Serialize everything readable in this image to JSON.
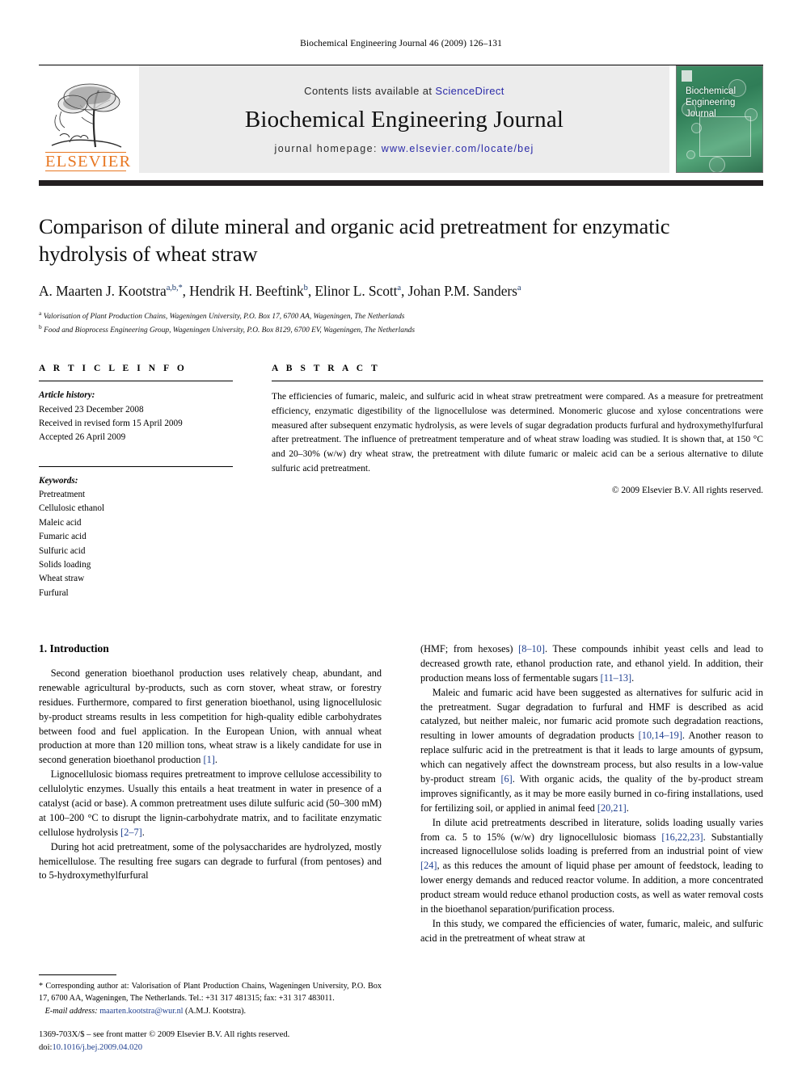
{
  "running_head": "Biochemical Engineering Journal 46 (2009) 126–131",
  "masthead": {
    "contents_prefix": "Contents lists available at ",
    "sciencedirect": "ScienceDirect",
    "journal_name": "Biochemical Engineering Journal",
    "homepage_prefix": "journal homepage: ",
    "homepage_url": "www.elsevier.com/locate/bej",
    "elsevier_word": "ELSEVIER",
    "cover_title_line1": "Biochemical",
    "cover_title_line2": "Engineering",
    "cover_title_line3": "Journal"
  },
  "colors": {
    "elsevier_orange": "#E87722",
    "link_blue": "#1f3f8f",
    "sciencedirect_blue": "#2a2aa8",
    "masthead_gray": "#ececec",
    "rule_black": "#231f20",
    "cover_green": "#3d8c63"
  },
  "article": {
    "title": "Comparison of dilute mineral and organic acid pretreatment for enzymatic hydrolysis of wheat straw",
    "authors_html": "A. Maarten J. Kootstra<sup>a,b,*</sup>, Hendrik H. Beeftink<sup>b</sup>, Elinor L. Scott<sup>a</sup>, Johan P.M. Sanders<sup>a</sup>",
    "affiliation_a": "Valorisation of Plant Production Chains, Wageningen University, P.O. Box 17, 6700 AA, Wageningen, The Netherlands",
    "affiliation_b": "Food and Bioprocess Engineering Group, Wageningen University, P.O. Box 8129, 6700 EV, Wageningen, The Netherlands"
  },
  "article_info": {
    "heading": "A R T I C L E    I N F O",
    "history_label": "Article history:",
    "history": [
      "Received 23 December 2008",
      "Received in revised form 15 April 2009",
      "Accepted 26 April 2009"
    ],
    "keywords_label": "Keywords:",
    "keywords": [
      "Pretreatment",
      "Cellulosic ethanol",
      "Maleic acid",
      "Fumaric acid",
      "Sulfuric acid",
      "Solids loading",
      "Wheat straw",
      "Furfural"
    ]
  },
  "abstract": {
    "heading": "A B S T R A C T",
    "text": "The efficiencies of fumaric, maleic, and sulfuric acid in wheat straw pretreatment were compared. As a measure for pretreatment efficiency, enzymatic digestibility of the lignocellulose was determined. Monomeric glucose and xylose concentrations were measured after subsequent enzymatic hydrolysis, as were levels of sugar degradation products furfural and hydroxymethylfurfural after pretreatment. The influence of pretreatment temperature and of wheat straw loading was studied. It is shown that, at 150 °C and 20–30% (w/w) dry wheat straw, the pretreatment with dilute fumaric or maleic acid can be a serious alternative to dilute sulfuric acid pretreatment.",
    "copyright": "© 2009 Elsevier B.V. All rights reserved."
  },
  "body": {
    "section_title": "1.  Introduction",
    "left_paragraphs": [
      "Second generation bioethanol production uses relatively cheap, abundant, and renewable agricultural by-products, such as corn stover, wheat straw, or forestry residues. Furthermore, compared to first generation bioethanol, using lignocellulosic by-product streams results in less competition for high-quality edible carbohydrates between food and fuel application. In the European Union, with annual wheat production at more than 120 million tons, wheat straw is a likely candidate for use in second generation bioethanol production [1].",
      "Lignocellulosic biomass requires pretreatment to improve cellulose accessibility to cellulolytic enzymes. Usually this entails a heat treatment in water in presence of a catalyst (acid or base). A common pretreatment uses dilute sulfuric acid (50–300 mM) at 100–200 °C to disrupt the lignin-carbohydrate matrix, and to facilitate enzymatic cellulose hydrolysis [2–7].",
      "During hot acid pretreatment, some of the polysaccharides are hydrolyzed, mostly hemicellulose. The resulting free sugars can degrade to furfural (from pentoses) and to 5-hydroxymethylfurfural"
    ],
    "right_paragraphs": [
      "(HMF; from hexoses) [8–10]. These compounds inhibit yeast cells and lead to decreased growth rate, ethanol production rate, and ethanol yield. In addition, their production means loss of fermentable sugars [11–13].",
      "Maleic and fumaric acid have been suggested as alternatives for sulfuric acid in the pretreatment. Sugar degradation to furfural and HMF is described as acid catalyzed, but neither maleic, nor fumaric acid promote such degradation reactions, resulting in lower amounts of degradation products [10,14–19]. Another reason to replace sulfuric acid in the pretreatment is that it leads to large amounts of gypsum, which can negatively affect the downstream process, but also results in a low-value by-product stream [6]. With organic acids, the quality of the by-product stream improves significantly, as it may be more easily burned in co-firing installations, used for fertilizing soil, or applied in animal feed [20,21].",
      "In dilute acid pretreatments described in literature, solids loading usually varies from ca. 5 to 15% (w/w) dry lignocellulosic biomass [16,22,23]. Substantially increased lignocellulose solids loading is preferred from an industrial point of view [24], as this reduces the amount of liquid phase per amount of feedstock, leading to lower energy demands and reduced reactor volume. In addition, a more concentrated product stream would reduce ethanol production costs, as well as water removal costs in the bioethanol separation/purification process.",
      "In this study, we compared the efficiencies of water, fumaric, maleic, and sulfuric acid in the pretreatment of wheat straw at"
    ]
  },
  "footnotes": {
    "corresponding": "*  Corresponding author at: Valorisation of Plant Production Chains, Wageningen University, P.O. Box 17, 6700 AA, Wageningen, The Netherlands. Tel.: +31 317 481315; fax: +31 317 483011.",
    "email_label": "E-mail address:",
    "email": "maarten.kootstra@wur.nl",
    "email_suffix": "(A.M.J. Kootstra).",
    "issn_line": "1369-703X/$ – see front matter © 2009 Elsevier B.V. All rights reserved.",
    "doi_label": "doi:",
    "doi": "10.1016/j.bej.2009.04.020"
  }
}
